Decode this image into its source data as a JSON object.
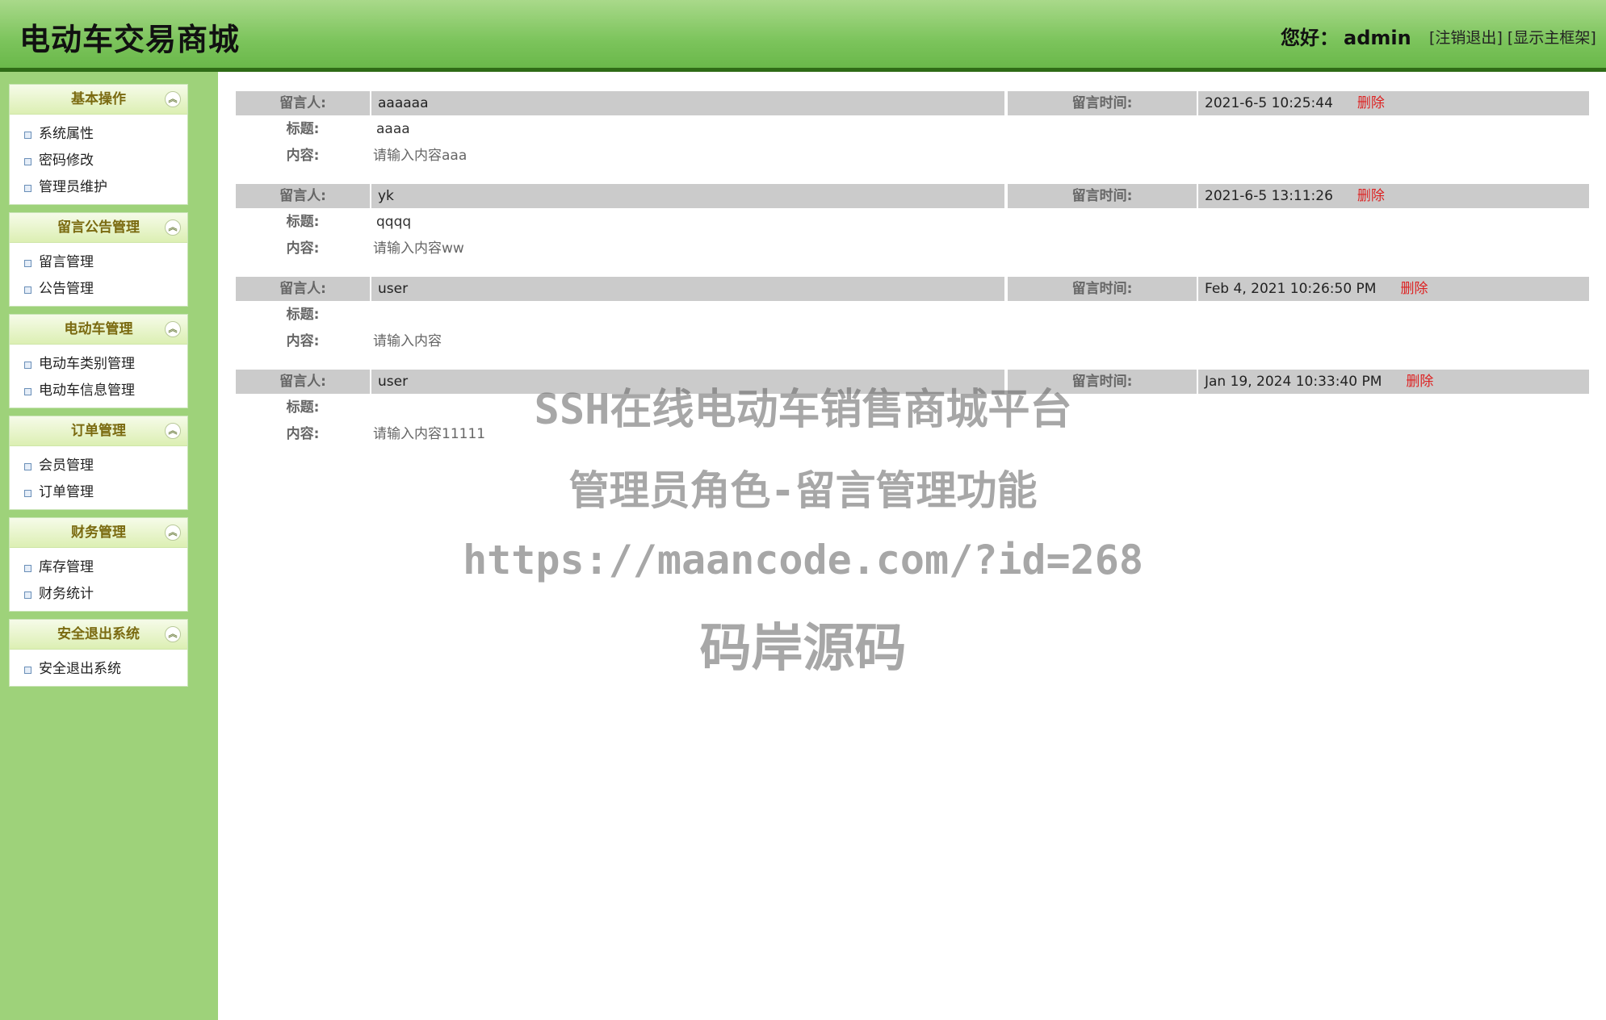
{
  "header": {
    "title": "电动车交易商城",
    "greeting": "您好：",
    "username": "admin",
    "logout_link": "注销退出",
    "show_frame_link": "显示主框架"
  },
  "sidebar": {
    "panels": [
      {
        "title": "基本操作",
        "items": [
          "系统属性",
          "密码修改",
          "管理员维护"
        ]
      },
      {
        "title": "留言公告管理",
        "items": [
          "留言管理",
          "公告管理"
        ]
      },
      {
        "title": "电动车管理",
        "items": [
          "电动车类别管理",
          "电动车信息管理"
        ]
      },
      {
        "title": "订单管理",
        "items": [
          "会员管理",
          "订单管理"
        ]
      },
      {
        "title": "财务管理",
        "items": [
          "库存管理",
          "财务统计"
        ]
      },
      {
        "title": "安全退出系统",
        "items": [
          "安全退出系统"
        ]
      }
    ]
  },
  "labels": {
    "author": "留言人:",
    "time": "留言时间:",
    "subject": "标题:",
    "content": "内容:",
    "delete": "删除"
  },
  "messages": [
    {
      "author": "aaaaaa",
      "time": "2021-6-5 10:25:44",
      "subject": "aaaa",
      "content": "请输入内容aaa"
    },
    {
      "author": "yk",
      "time": "2021-6-5 13:11:26",
      "subject": "qqqq",
      "content": "请输入内容ww"
    },
    {
      "author": "user",
      "time": "Feb 4, 2021 10:26:50 PM",
      "subject": "",
      "content": "请输入内容"
    },
    {
      "author": "user",
      "time": "Jan 19, 2024 10:33:40 PM",
      "subject": "",
      "content": "请输入内容11111"
    }
  ],
  "watermark": {
    "line1": "SSH在线电动车销售商城平台",
    "line2": "管理员角色-留言管理功能",
    "line3": "https://maancode.com/?id=268",
    "line4": "码岸源码"
  }
}
